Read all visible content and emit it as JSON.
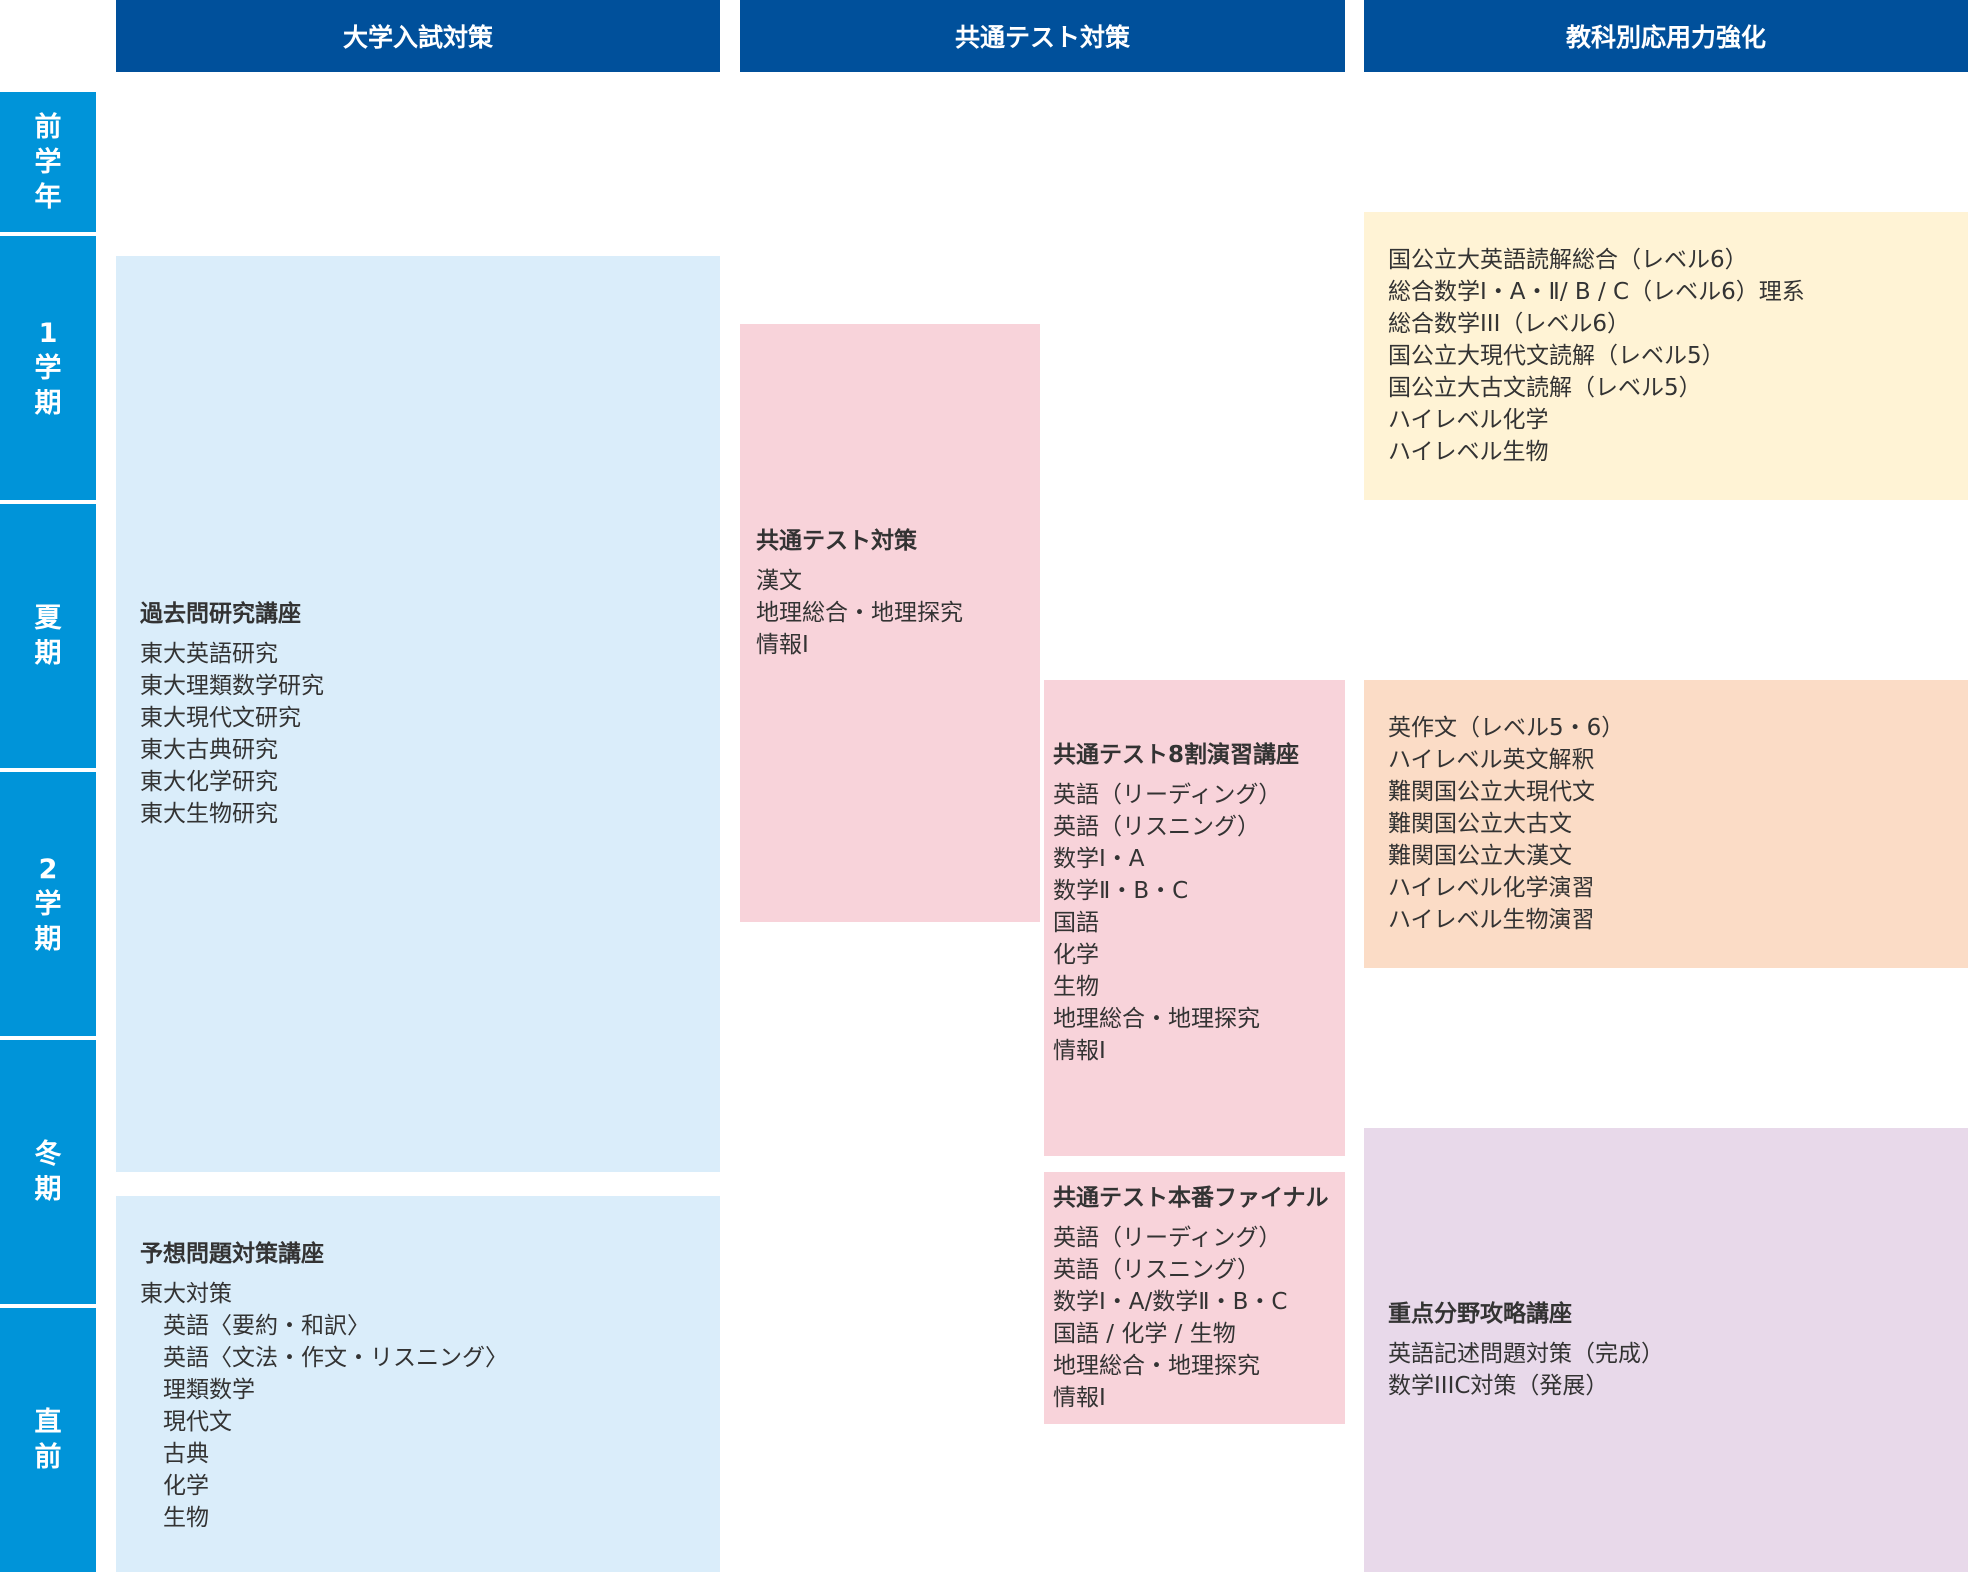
{
  "columns": {
    "c1": "大学入試対策",
    "c2": "共通テスト対策",
    "c3": "教科別応用力強化"
  },
  "terms": {
    "t1": "前学年",
    "t2": "1学期",
    "t3": "夏期",
    "t4": "2学期",
    "t5": "冬期",
    "t6": "直前"
  },
  "blocks": {
    "kakomon": {
      "title": "過去問研究講座",
      "items": [
        "東大英語研究",
        "東大理類数学研究",
        "東大現代文研究",
        "東大古典研究",
        "東大化学研究",
        "東大生物研究"
      ]
    },
    "yosou": {
      "title": "予想問題対策講座",
      "items": [
        "東大対策",
        "　英語〈要約・和訳〉",
        "　英語〈文法・作文・リスニング〉",
        "　理類数学",
        "　現代文",
        "　古典",
        "　化学",
        "　生物"
      ]
    },
    "kyotsu": {
      "title": "共通テスト対策",
      "items": [
        "漢文",
        "地理総合・地理探究",
        "情報I"
      ]
    },
    "hachiwari": {
      "title": "共通テスト8割演習講座",
      "items": [
        "英語（リーディング）",
        "英語（リスニング）",
        "数学Ⅰ・A",
        "数学Ⅱ・B・C",
        "国語",
        "化学",
        "生物",
        "地理総合・地理探究",
        "情報Ⅰ"
      ]
    },
    "honban": {
      "title": "共通テスト本番ファイナル",
      "items": [
        "英語（リーディング）",
        "英語（リスニング）",
        "数学Ⅰ・A/数学Ⅱ・B・C",
        "国語 / 化学 / 生物",
        "地理総合・地理探究",
        "情報Ⅰ"
      ]
    },
    "level": {
      "items": [
        "国公立大英語読解総合（レベル6）",
        "総合数学Ⅰ・A・Ⅱ/ B / C（レベル6）理系",
        "総合数学III（レベル6）",
        "国公立大現代文読解（レベル5）",
        "国公立大古文読解（レベル5）",
        "ハイレベル化学",
        "ハイレベル生物"
      ]
    },
    "nankan": {
      "items": [
        "英作文（レベル5・6）",
        "ハイレベル英文解釈",
        "難関国公立大現代文",
        "難関国公立大古文",
        "難関国公立大漢文",
        "ハイレベル化学演習",
        "ハイレベル生物演習"
      ]
    },
    "juten": {
      "title": "重点分野攻略講座",
      "items": [
        "英語記述問題対策（完成）",
        "数学IIIC対策（発展）"
      ]
    }
  }
}
